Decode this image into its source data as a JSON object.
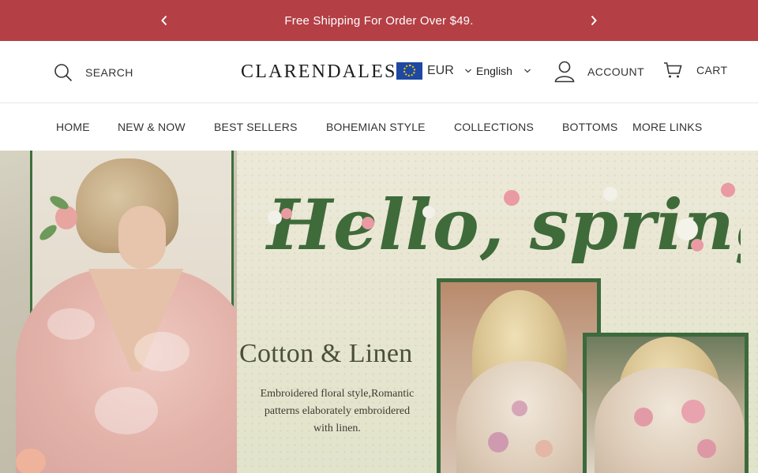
{
  "announcement": {
    "message": "Free Shipping For Order Over $49.",
    "prev_icon": "chevron-left-icon",
    "next_icon": "chevron-right-icon"
  },
  "header": {
    "search_label": "SEARCH",
    "logo": "CLARENDALES",
    "currency": {
      "code": "EUR",
      "flag": "eu-flag-icon"
    },
    "language": "English",
    "account_label": "ACCOUNT",
    "cart_label": "CART"
  },
  "nav": {
    "items": [
      {
        "label": "HOME"
      },
      {
        "label": "NEW & NOW"
      },
      {
        "label": "BEST SELLERS"
      },
      {
        "label": "BOHEMIAN STYLE"
      },
      {
        "label": "COLLECTIONS"
      },
      {
        "label": "BOTTOMS"
      },
      {
        "label": "MORE LINKS"
      }
    ]
  },
  "hero": {
    "headline": "Hello, spring!",
    "subheadline": "Cotton & Linen",
    "description_lines": [
      "Embroidered floral style,Romantic",
      "patterns elaborately embroidered",
      "with linen."
    ]
  },
  "colors": {
    "announcement_bg": "#b43f45",
    "frame_green": "#3c6a3d",
    "headline_green": "#3f6b3a"
  }
}
